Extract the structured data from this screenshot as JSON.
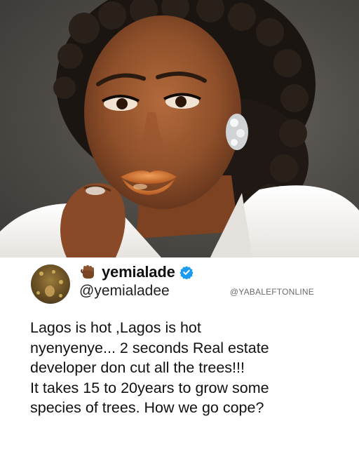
{
  "tweet": {
    "display_name": "yemialade",
    "handle": "@yemialadee",
    "watermark": "@YABALEFTONLINE",
    "verified": true,
    "name_emoji": "raised-fist",
    "text_lines": [
      "Lagos is hot ,Lagos is hot",
      "nyenyenye... 2 seconds Real estate",
      "developer don cut all the trees!!!",
      "It takes 15 to 20years to grow some",
      "species of trees. How we go cope?"
    ]
  },
  "colors": {
    "verified_badge": "#1d9bf0",
    "photo_background": "#4d4a46",
    "jacket": "#f4f2ef",
    "lips": "#d9762f"
  },
  "icons": {
    "name_emoji": "raised-fist-icon",
    "badge": "verified-badge-icon"
  }
}
